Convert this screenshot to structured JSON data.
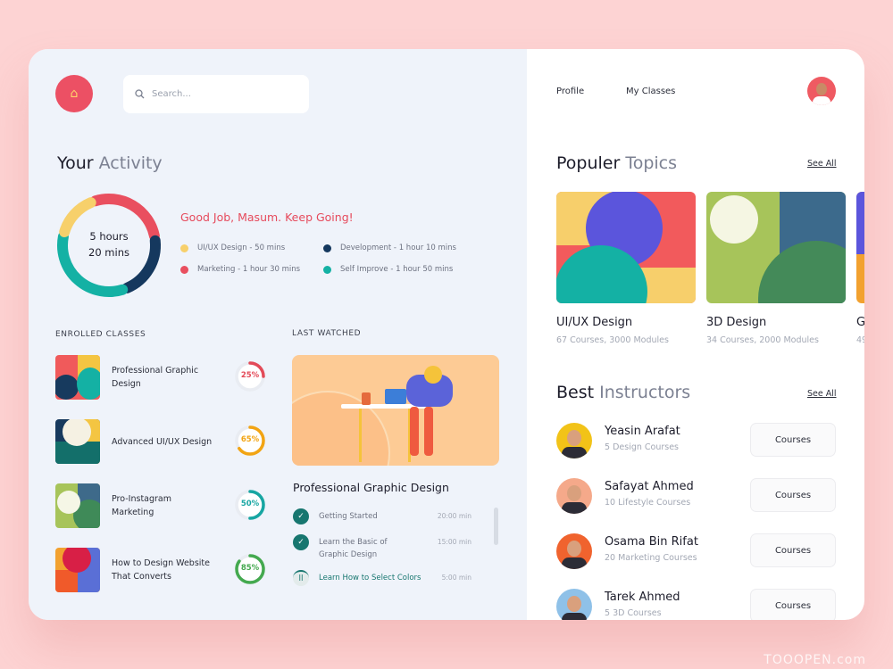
{
  "search": {
    "placeholder": "Search..."
  },
  "nav": {
    "profile": "Profile",
    "my_classes": "My Classes"
  },
  "activity": {
    "title_bold": "Your",
    "title_light": "Activity",
    "total_line1": "5 hours",
    "total_line2": "20 mins",
    "message": "Good Job, Masum. Keep Going!",
    "items": [
      {
        "label": "UI/UX Design -  50 mins",
        "minutes": 50,
        "color": "#f7d06b"
      },
      {
        "label": "Development - 1 hour 10 mins",
        "minutes": 70,
        "color": "#15385e"
      },
      {
        "label": "Marketing - 1 hour 30 mins",
        "minutes": 90,
        "color": "#e94f5f"
      },
      {
        "label": "Self Improve - 1 hour 50 mins",
        "minutes": 110,
        "color": "#14b1a4"
      }
    ]
  },
  "enrolled": {
    "title": "ENROLLED CLASSES",
    "items": [
      {
        "name": "Professional Graphic Design",
        "progress": "25%",
        "value": 25,
        "color": "#e34a58"
      },
      {
        "name": "Advanced UI/UX Design",
        "progress": "65%",
        "value": 65,
        "color": "#f2a413"
      },
      {
        "name": "Pro-Instagram Marketing",
        "progress": "50%",
        "value": 50,
        "color": "#17a6a2"
      },
      {
        "name": "How to Design Website That Converts",
        "progress": "85%",
        "value": 85,
        "color": "#44a94f"
      }
    ]
  },
  "last_watched": {
    "title": "LAST WATCHED",
    "course": "Professional Graphic Design",
    "lessons": [
      {
        "title": "Getting Started",
        "time": "20:00 min",
        "status": "done"
      },
      {
        "title": "Learn the Basic of Graphic Design",
        "time": "15:00 min",
        "status": "done"
      },
      {
        "title": "Learn How to Select Colors",
        "time": "5:00 min",
        "status": "playing"
      }
    ]
  },
  "topics": {
    "title_bold": "Populer",
    "title_light": "Topics",
    "see_all": "See All",
    "items": [
      {
        "name": "UI/UX Design",
        "sub": "67 Courses, 3000 Modules"
      },
      {
        "name": "3D Design",
        "sub": "34 Courses, 2000 Modules"
      },
      {
        "name": "G",
        "sub": "49"
      }
    ]
  },
  "instructors": {
    "title_bold": "Best",
    "title_light": "Instructors",
    "see_all": "See All",
    "button": "Courses",
    "items": [
      {
        "name": "Yeasin Arafat",
        "sub": "5 Design Courses",
        "color": "#f2c318"
      },
      {
        "name": "Safayat Ahmed",
        "sub": "10 Lifestyle Courses",
        "color": "#f5a98a"
      },
      {
        "name": "Osama Bin Rifat",
        "sub": "20 Marketing Courses",
        "color": "#f0632e"
      },
      {
        "name": "Tarek Ahmed",
        "sub": "5 3D Courses",
        "color": "#8fc1e8"
      }
    ]
  },
  "watermark": "TOOOPEN.com"
}
